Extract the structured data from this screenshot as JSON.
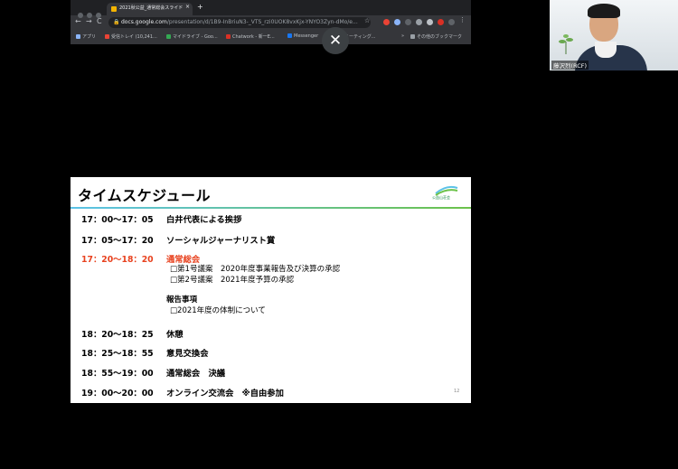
{
  "browser": {
    "tab_title": "2021秋公益_通常総会スライド",
    "tab_close": "×",
    "new_tab": "+",
    "nav_back": "←",
    "nav_forward": "→",
    "nav_reload": "C",
    "lock": "🔒",
    "url_domain": "docs.google.com",
    "url_path": "/presentation/d/1B9-InBriuN3-_VTS_rzi0UOK8vxKjx-YNYO3Zyn-dMo/e...",
    "star": "☆",
    "bookmarks": [
      {
        "label": "アプリ",
        "color": "#8ab4f8"
      },
      {
        "label": "受信トレイ (10,241...",
        "color": "#ea4335"
      },
      {
        "label": "マイドライブ - Goo...",
        "color": "#34a853"
      },
      {
        "label": "Chatwork - 新一E...",
        "color": "#d93025"
      },
      {
        "label": "Messenger",
        "color": "#1877f2"
      },
      {
        "label": "ミーティング...",
        "color": "#fbbc04"
      },
      {
        "label": "»",
        "color": ""
      },
      {
        "label": "その他のブックマーク",
        "color": "#9aa0a6"
      }
    ]
  },
  "close_button": "✕",
  "slide": {
    "title": "タイムスケジュール",
    "logo_text": "公益山荘会",
    "rows": [
      {
        "time": "17：00〜17：05",
        "text": "白井代表による挨拶"
      },
      {
        "time": "17：05〜17：20",
        "text": "ソーシャルジャーナリスト賞"
      },
      {
        "time": "17：20〜18：20",
        "text": "通常総会"
      },
      {
        "time": "18：20〜18：25",
        "text": "休憩"
      },
      {
        "time": "18：25〜18：55",
        "text": "意見交換会"
      },
      {
        "time": "18：55〜19：00",
        "text": "通常総会　決議"
      },
      {
        "time": "19：00〜20：00",
        "text": "オンライン交流会　※自由参加"
      }
    ],
    "agenda": [
      "□第1号議案　2020年度事業報告及び決算の承認",
      "□第2号議案　2021年度予算の承認"
    ],
    "report_heading": "報告事項",
    "report_items": [
      "□2021年度の体制について"
    ],
    "page_number": "12",
    "accent_color": "#e8421f"
  },
  "participant": {
    "name": "藤沢烈(RCF)"
  }
}
